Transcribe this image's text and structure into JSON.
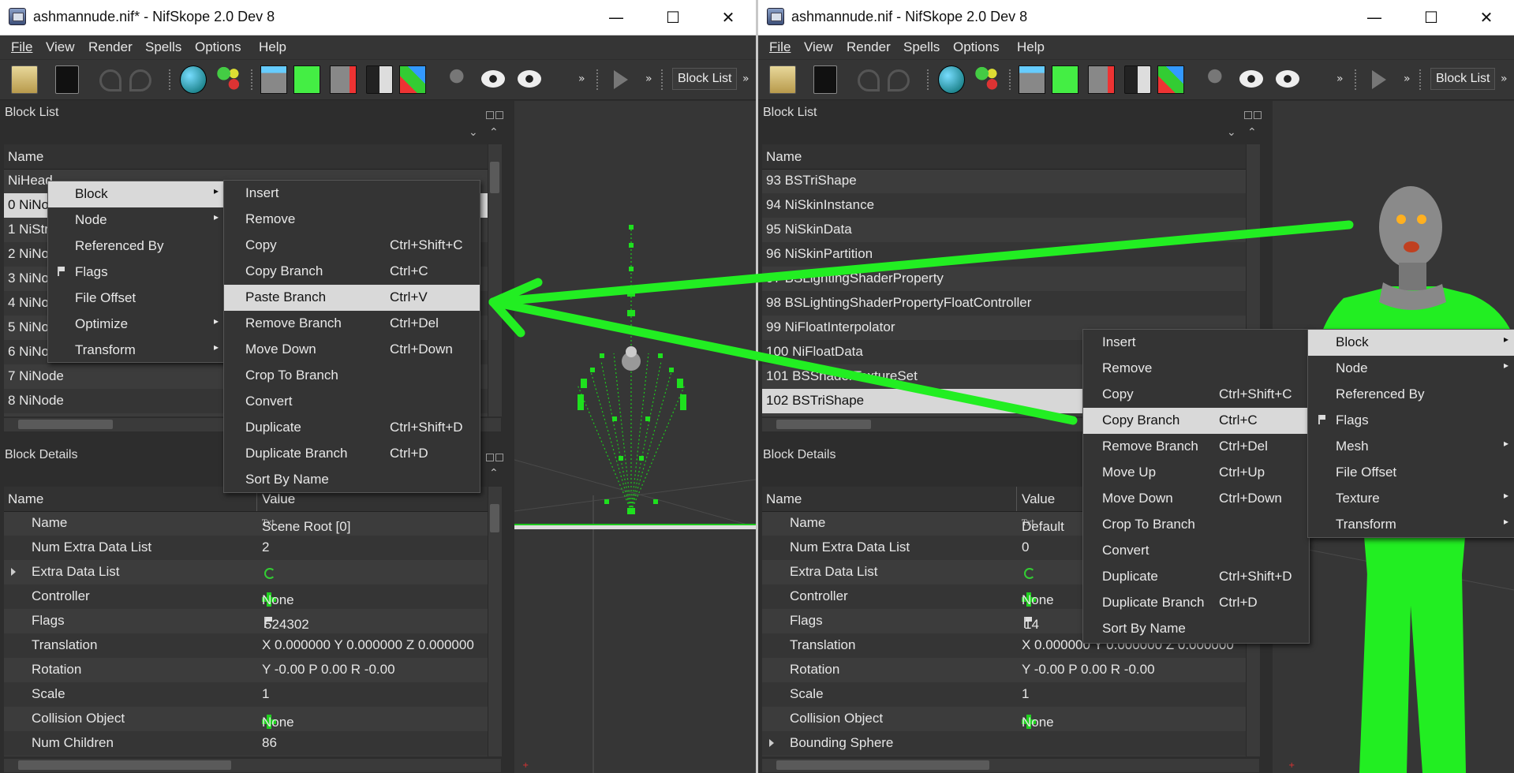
{
  "windows": [
    {
      "title": "ashmannude.nif* - NifSkope 2.0 Dev 8",
      "menu": [
        "File",
        "View",
        "Render",
        "Spells",
        "Options",
        "Help"
      ],
      "toolbar_label": "Block List",
      "block_list": {
        "title": "Block List",
        "column": "Name",
        "rows": [
          "NiHead",
          "0 NiNo",
          "1 NiStr",
          "2 NiNo",
          "3 NiNo",
          "4 NiNo",
          "5 NiNo",
          "6 NiNo",
          "7 NiNode",
          "8 NiNode"
        ]
      },
      "context_menu": [
        "Block",
        "Node",
        "Referenced By",
        "Flags",
        "File Offset",
        "Optimize",
        "Transform"
      ],
      "submenu": [
        {
          "label": "Insert",
          "shortcut": ""
        },
        {
          "label": "Remove",
          "shortcut": ""
        },
        {
          "label": "Copy",
          "shortcut": "Ctrl+Shift+C"
        },
        {
          "label": "Copy Branch",
          "shortcut": "Ctrl+C"
        },
        {
          "label": "Paste Branch",
          "shortcut": "Ctrl+V"
        },
        {
          "label": "Remove Branch",
          "shortcut": "Ctrl+Del"
        },
        {
          "label": "Move Down",
          "shortcut": "Ctrl+Down"
        },
        {
          "label": "Crop To Branch",
          "shortcut": ""
        },
        {
          "label": "Convert",
          "shortcut": ""
        },
        {
          "label": "Duplicate",
          "shortcut": "Ctrl+Shift+D"
        },
        {
          "label": "Duplicate Branch",
          "shortcut": "Ctrl+D"
        },
        {
          "label": "Sort By Name",
          "shortcut": ""
        }
      ],
      "block_details": {
        "title": "Block Details",
        "col_name": "Name",
        "col_value": "Value",
        "rows": [
          {
            "name": "Name",
            "value": "Scene Root [0]"
          },
          {
            "name": "Num Extra Data List",
            "value": "2"
          },
          {
            "name": "Extra Data List",
            "value": ""
          },
          {
            "name": "Controller",
            "value": "None"
          },
          {
            "name": "Flags",
            "value": "524302"
          },
          {
            "name": "Translation",
            "value": "X 0.000000 Y 0.000000 Z 0.000000"
          },
          {
            "name": "Rotation",
            "value": "Y -0.00 P 0.00 R -0.00"
          },
          {
            "name": "Scale",
            "value": "1"
          },
          {
            "name": "Collision Object",
            "value": "None"
          },
          {
            "name": "Num Children",
            "value": "86"
          }
        ]
      }
    },
    {
      "title": "ashmannude.nif - NifSkope 2.0 Dev 8",
      "menu": [
        "File",
        "View",
        "Render",
        "Spells",
        "Options",
        "Help"
      ],
      "toolbar_label": "Block List",
      "block_list": {
        "title": "Block List",
        "column": "Name",
        "rows": [
          "93 BSTriShape",
          "94 NiSkinInstance",
          "95 NiSkinData",
          "96 NiSkinPartition",
          "97 BSLightingShaderProperty",
          "98 BSLightingShaderPropertyFloatController",
          "99 NiFloatInterpolator",
          "100 NiFloatData",
          "101 BSShaderTextureSet",
          "102 BSTriShape"
        ]
      },
      "context_menu": [
        {
          "label": "Insert",
          "shortcut": ""
        },
        {
          "label": "Remove",
          "shortcut": ""
        },
        {
          "label": "Copy",
          "shortcut": "Ctrl+Shift+C"
        },
        {
          "label": "Copy Branch",
          "shortcut": "Ctrl+C"
        },
        {
          "label": "Remove Branch",
          "shortcut": "Ctrl+Del"
        },
        {
          "label": "Move Up",
          "shortcut": "Ctrl+Up"
        },
        {
          "label": "Move Down",
          "shortcut": "Ctrl+Down"
        },
        {
          "label": "Crop To Branch",
          "shortcut": ""
        },
        {
          "label": "Convert",
          "shortcut": ""
        },
        {
          "label": "Duplicate",
          "shortcut": "Ctrl+Shift+D"
        },
        {
          "label": "Duplicate Branch",
          "shortcut": "Ctrl+D"
        },
        {
          "label": "Sort By Name",
          "shortcut": ""
        }
      ],
      "submenu": [
        "Block",
        "Node",
        "Referenced By",
        "Flags",
        "Mesh",
        "File Offset",
        "Texture",
        "Transform"
      ],
      "block_details": {
        "title": "Block Details",
        "col_name": "Name",
        "col_value": "Value",
        "rows": [
          {
            "name": "Name",
            "value": "Default"
          },
          {
            "name": "Num Extra Data List",
            "value": "0"
          },
          {
            "name": "Extra Data List",
            "value": ""
          },
          {
            "name": "Controller",
            "value": "None"
          },
          {
            "name": "Flags",
            "value": "14"
          },
          {
            "name": "Translation",
            "value": "X 0.000000 Y 0.000000 Z 0.000000"
          },
          {
            "name": "Rotation",
            "value": "Y -0.00 P 0.00 R -0.00"
          },
          {
            "name": "Scale",
            "value": "1"
          },
          {
            "name": "Collision Object",
            "value": "None"
          },
          {
            "name": "Bounding Sphere",
            "value": ""
          }
        ]
      }
    }
  ],
  "icons": {
    "txt_icon": "Txt",
    "min": "—",
    "max": "☐",
    "close": "✕",
    "chev": "»",
    "arrow": "▸"
  },
  "annotation_color": "#22ee22"
}
